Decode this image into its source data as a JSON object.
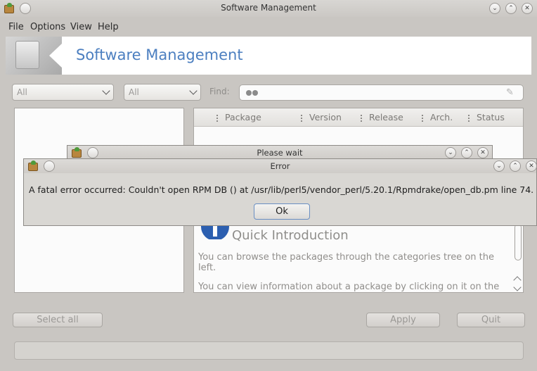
{
  "window": {
    "title": "Software Management",
    "buttons": {
      "minimize": "⌄",
      "maximize": "⌃",
      "close": "✕"
    }
  },
  "menu": [
    "File",
    "Options",
    "View",
    "Help"
  ],
  "banner": {
    "title": "Software Management"
  },
  "filters": {
    "category": "All",
    "type": "All",
    "find_label": "Find:",
    "find_value": ""
  },
  "columns": [
    "Package",
    "Version",
    "Release",
    "Arch.",
    "Status"
  ],
  "intro": {
    "title": "Quick Introduction",
    "para1": "You can browse the packages through the categories tree on the left.",
    "para2": "You can view information about a package by clicking on it on the"
  },
  "buttons": {
    "select_all": "Select all",
    "apply": "Apply",
    "quit": "Quit"
  },
  "wait_dialog": {
    "title": "Please wait"
  },
  "error_dialog": {
    "title": "Error",
    "message": "A fatal error occurred: Couldn't open RPM DB () at /usr/lib/perl5/vendor_perl/5.20.1/Rpmdrake/open_db.pm line 74. .",
    "ok_label": "Ok"
  },
  "colors": {
    "accent": "#4c7fc0",
    "info_icon": "#2c5fb0"
  }
}
